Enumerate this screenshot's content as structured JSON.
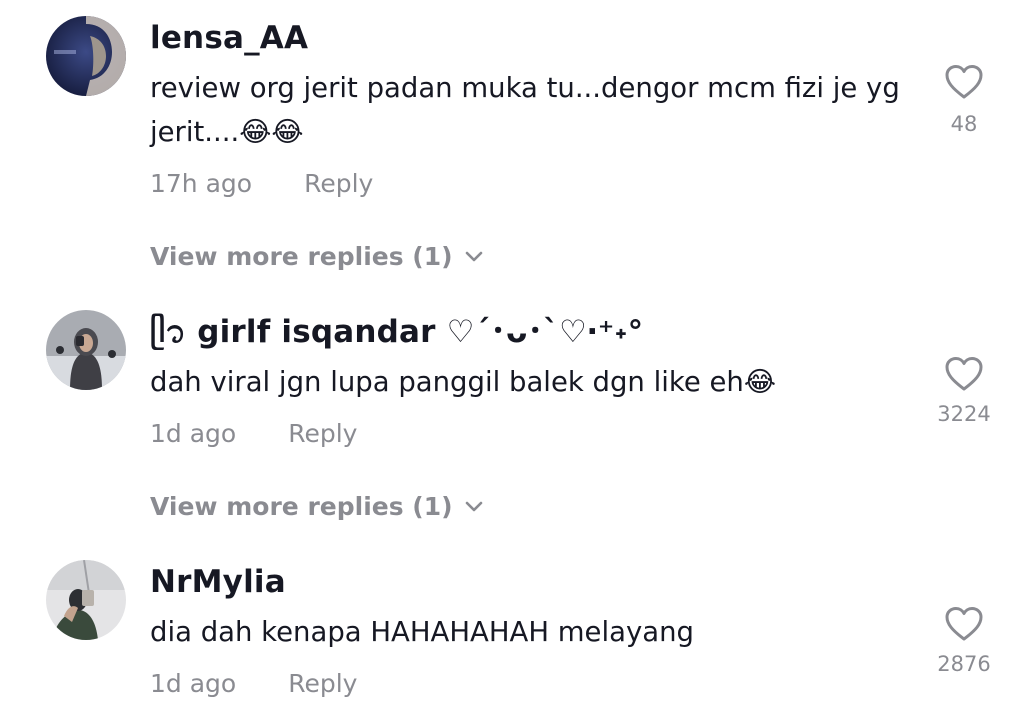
{
  "comments": [
    {
      "username": "lensa_AA",
      "text": "review org jerit padan muka tu...dengor mcm fizi je yg jerit....😂😂",
      "time": "17h ago",
      "reply_label": "Reply",
      "likes": "48",
      "view_more": "View more replies (1)"
    },
    {
      "username": "ᥫ᭡ girlf isqandar ♡´･ᴗ･`♡‧⁺˖°",
      "text": "dah viral jgn lupa panggil balek dgn like eh😂",
      "time": "1d ago",
      "reply_label": "Reply",
      "likes": "3224",
      "view_more": "View more replies (1)"
    },
    {
      "username": "NrMylia",
      "text": "dia dah kenapa HAHAHAHAH melayang",
      "time": "1d ago",
      "reply_label": "Reply",
      "likes": "2876"
    }
  ],
  "colors": {
    "text_primary": "#161823",
    "text_secondary": "#8a8b91",
    "background": "#ffffff"
  },
  "icons": {
    "like": "heart-outline-icon",
    "expand": "chevron-down-icon"
  }
}
